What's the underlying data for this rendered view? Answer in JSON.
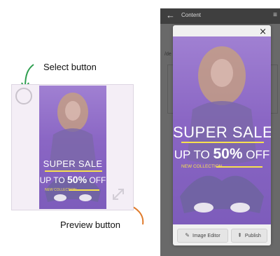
{
  "annotations": {
    "select_label": "Select button",
    "preview_label": "Preview button"
  },
  "poster": {
    "title": "SUPER SALE",
    "sub_prefix": "UP TO ",
    "sub_amount": "50%",
    "sub_suffix": " OFF",
    "tagline": "NEW COLLECTION"
  },
  "phone": {
    "header_title": "Content",
    "path_text": "/de",
    "close_glyph": "×",
    "buttons": {
      "image_editor": "Image Editor",
      "publish": "Publish"
    }
  },
  "icons": {
    "select": "select-circle-icon",
    "preview": "expand-arrows-icon",
    "back": "arrow-left-icon",
    "menu": "hamburger-icon",
    "close": "close-icon",
    "image_editor": "pencil-icon",
    "publish": "upload-icon"
  },
  "colors": {
    "poster_purple": "#8d6bc6",
    "accent_yellow": "#f7e04e",
    "annotation_green": "#2e9e4f",
    "annotation_orange": "#e07b2c",
    "phone_bg": "#696969",
    "phone_header": "#3f3f3f"
  }
}
